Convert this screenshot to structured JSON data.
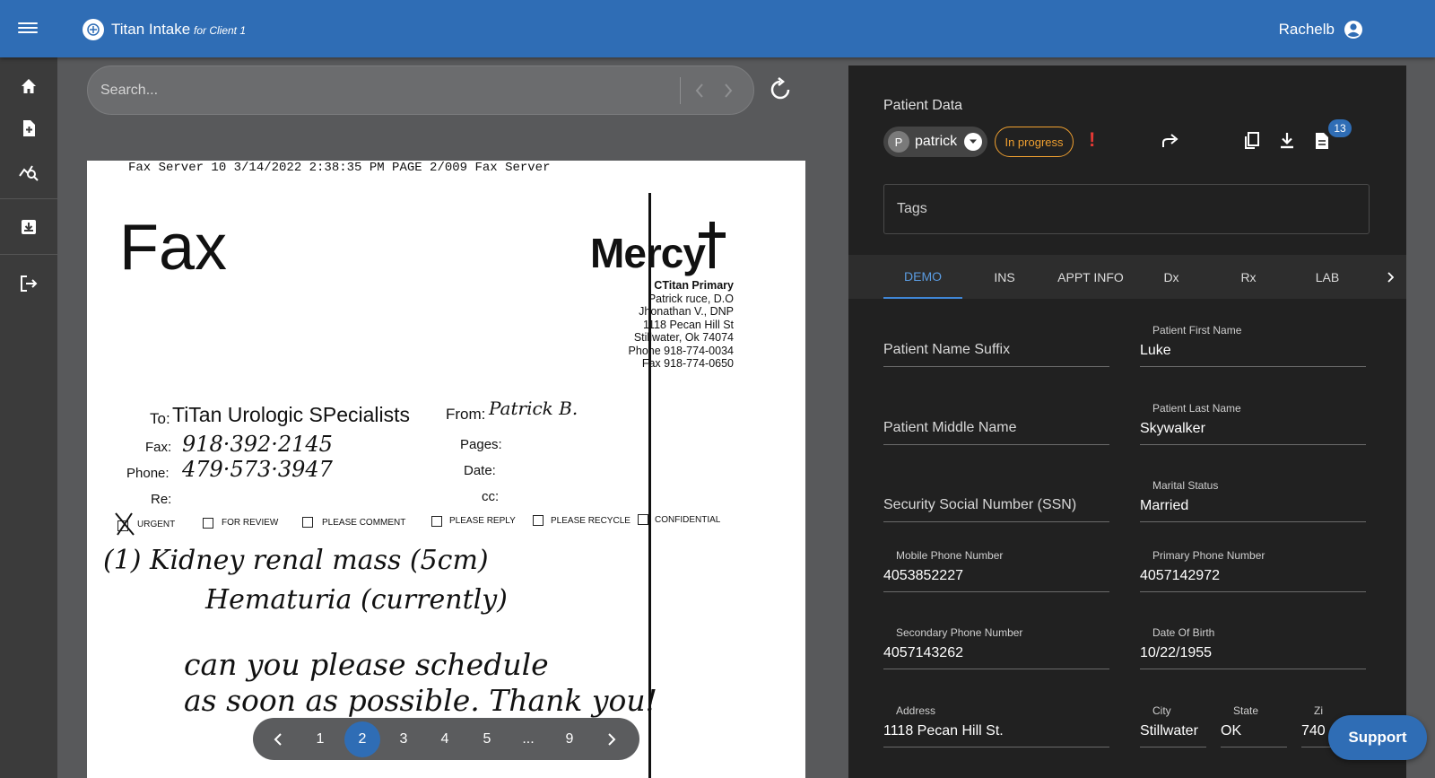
{
  "header": {
    "app_title": "Titan Intake",
    "app_subtitle": "for Client 1",
    "user_name": "Rachelb"
  },
  "search": {
    "placeholder": "Search..."
  },
  "fax": {
    "header_line": "Fax Server 10        3/14/2022 2:38:35 PM  PAGE   2/009   Fax Server",
    "title": "Fax",
    "brand": "Mercy",
    "clinic_lines": [
      "CTitan Primary",
      "Patrick ruce, D.O",
      "Jhonathan V., DNP",
      "1118 Pecan Hill St",
      "Stillwater, Ok 74074",
      "Phone 918-774-0034",
      "Fax 918-774-0650"
    ],
    "to_label": "To:",
    "to_value": "TiTan Urologic SPecialists",
    "from_label": "From:",
    "from_value": "Patrick B.",
    "fax_label": "Fax:",
    "fax_value": "918·392·2145",
    "phone_label": "Phone:",
    "phone_value": "479·573·3947",
    "re_label": "Re:",
    "pages_label": "Pages:",
    "date_label": "Date:",
    "cc_label": "cc:",
    "checkboxes": [
      "URGENT",
      "FOR REVIEW",
      "PLEASE COMMENT",
      "PLEASE REPLY",
      "PLEASE RECYCLE",
      "CONFIDENTIAL"
    ],
    "note_lines": [
      "(1) Kidney renal mass (5cm)",
      "Hematuria (currently)",
      "can you please schedule",
      "as soon as possible. Thank you!"
    ]
  },
  "pager": {
    "pages": [
      "1",
      "2",
      "3",
      "4",
      "5",
      "...",
      "9"
    ],
    "current": "2"
  },
  "panel": {
    "title": "Patient Data",
    "user_chip": {
      "initial": "P",
      "name": "patrick"
    },
    "status": "In progress",
    "alert": "!",
    "badge_count": "13",
    "tags_label": "Tags",
    "tabs": [
      "DEMO",
      "INS",
      "APPT INFO",
      "Dx",
      "Rx",
      "LAB"
    ],
    "active_tab": "DEMO",
    "fields": {
      "suffix": {
        "label": "Patient Name Suffix",
        "value": ""
      },
      "first_name": {
        "label": "Patient First Name",
        "value": "Luke"
      },
      "middle_name": {
        "label": "Patient Middle Name",
        "value": ""
      },
      "last_name": {
        "label": "Patient Last Name",
        "value": "Skywalker"
      },
      "ssn": {
        "label": "Security Social Number (SSN)",
        "value": ""
      },
      "marital": {
        "label": "Marital Status",
        "value": "Married"
      },
      "mobile": {
        "label": "Mobile Phone Number",
        "value": "4053852227"
      },
      "primary_phone": {
        "label": "Primary Phone Number",
        "value": "4057142972"
      },
      "secondary_phone": {
        "label": "Secondary Phone Number",
        "value": "4057143262"
      },
      "dob": {
        "label": "Date Of Birth",
        "value": "10/22/1955"
      },
      "address": {
        "label": "Address",
        "value": "1118 Pecan Hill St."
      },
      "city": {
        "label": "City",
        "value": "Stillwater"
      },
      "state": {
        "label": "State",
        "value": "OK"
      },
      "zip": {
        "label": "Zi",
        "value": "740"
      }
    }
  },
  "support_label": "Support",
  "colors": {
    "header": "#2f6db5",
    "panel": "#212121",
    "accent": "#3f86d6",
    "status": "#f0a030",
    "alert": "#e53935"
  }
}
